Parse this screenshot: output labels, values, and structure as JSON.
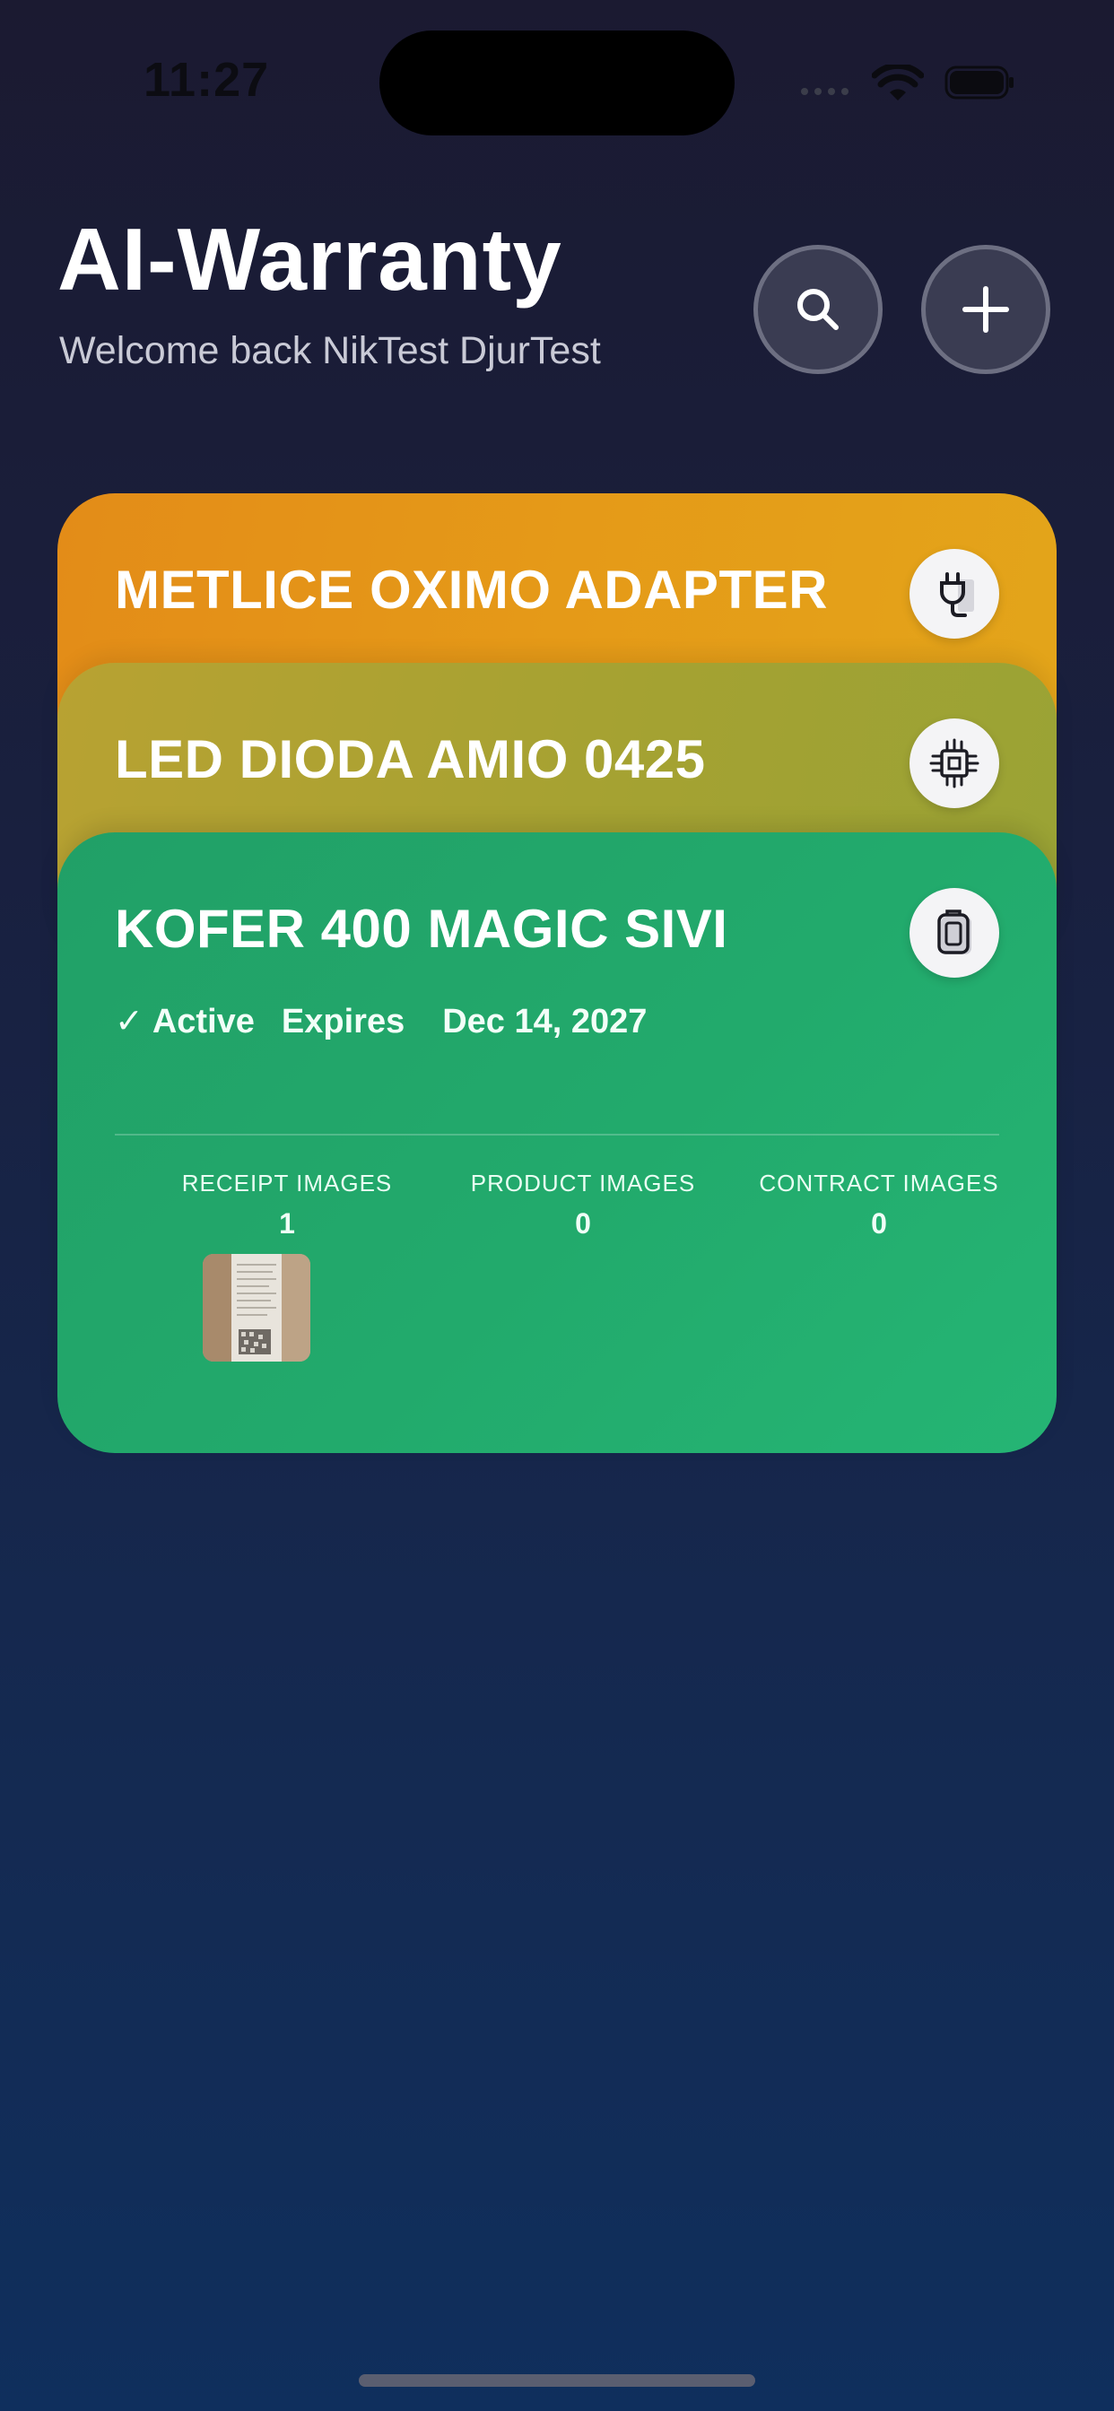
{
  "status_bar": {
    "time": "11:27"
  },
  "header": {
    "title": "AI-Warranty",
    "subtitle": "Welcome back NikTest DjurTest"
  },
  "cards": [
    {
      "title": "METLICE OXIMO ADAPTER",
      "icon": "plug-icon",
      "color": "#e3951a"
    },
    {
      "title": "LED DIODA AMIO 0425",
      "icon": "chip-icon",
      "color": "#a8a233"
    },
    {
      "title": "KOFER 400 MAGIC SIVI",
      "icon": "suitcase-icon",
      "color": "#22aa6c",
      "check": "✓",
      "status": "Active",
      "expires_label": "Expires",
      "expires_date": "Dec 14, 2027",
      "images": {
        "receipt": {
          "label": "RECEIPT IMAGES",
          "count": "1"
        },
        "product": {
          "label": "PRODUCT IMAGES",
          "count": "0"
        },
        "contract": {
          "label": "CONTRACT IMAGES",
          "count": "0"
        }
      }
    }
  ]
}
